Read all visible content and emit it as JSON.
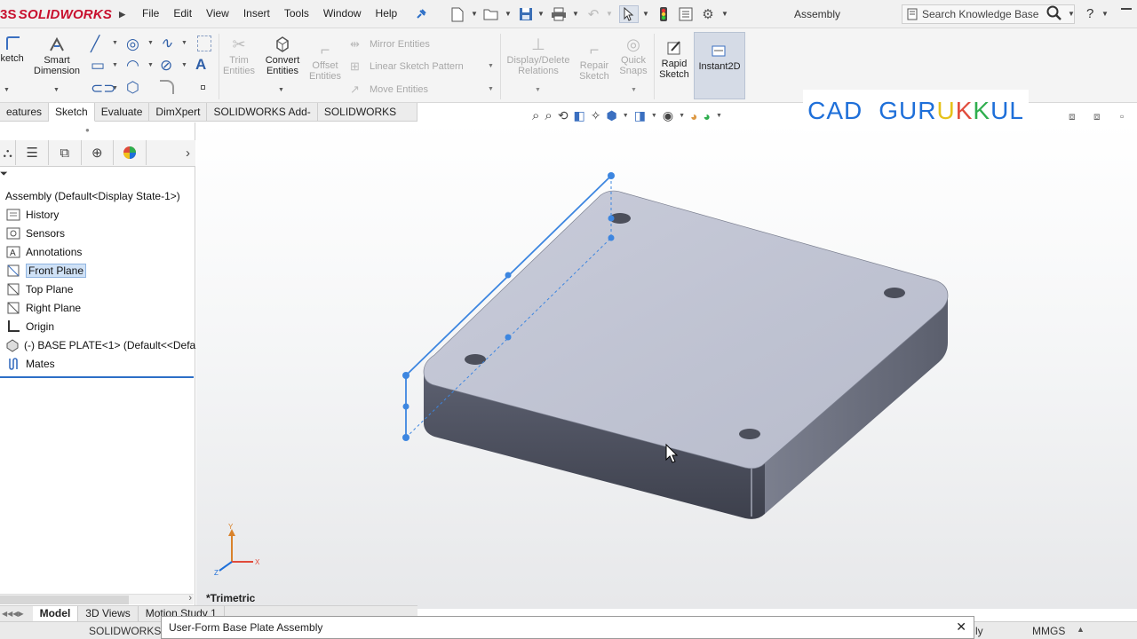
{
  "app": {
    "logo_prefix": "3S",
    "logo_name": "SOLIDWORKS",
    "document_title": "Assembly"
  },
  "menu": [
    "File",
    "Edit",
    "View",
    "Insert",
    "Tools",
    "Window",
    "Help"
  ],
  "search": {
    "placeholder": "Search Knowledge Base"
  },
  "help_label": "?",
  "ribbon": {
    "sketch_label": "Sketch",
    "smart_dimension": {
      "line1": "Smart",
      "line2": "Dimension"
    },
    "trim": {
      "line1": "Trim",
      "line2": "Entities"
    },
    "convert": {
      "line1": "Convert",
      "line2": "Entities"
    },
    "offset": {
      "line1": "Offset",
      "line2": "Entities"
    },
    "mirror_entities": "Mirror Entities",
    "linear_sketch_pattern": "Linear Sketch Pattern",
    "move_entities": "Move Entities",
    "display_delete": {
      "line1": "Display/Delete",
      "line2": "Relations"
    },
    "repair": {
      "line1": "Repair",
      "line2": "Sketch"
    },
    "quick_snaps": {
      "line1": "Quick",
      "line2": "Snaps"
    },
    "rapid_sketch": {
      "line1": "Rapid",
      "line2": "Sketch"
    },
    "instant2d": "Instant2D"
  },
  "command_tabs": [
    "eatures",
    "Sketch",
    "Evaluate",
    "DimXpert",
    "SOLIDWORKS Add-Ins",
    "SOLIDWORKS MBD"
  ],
  "active_tab": "Sketch",
  "feature_tree": {
    "root": "Assembly  (Default<Display State-1>)",
    "items": [
      {
        "label": "History",
        "icon": "history-icon"
      },
      {
        "label": "Sensors",
        "icon": "sensors-icon"
      },
      {
        "label": "Annotations",
        "icon": "annotations-icon"
      },
      {
        "label": "Front Plane",
        "icon": "plane-icon",
        "selected": true
      },
      {
        "label": "Top Plane",
        "icon": "plane-icon"
      },
      {
        "label": "Right Plane",
        "icon": "plane-icon"
      },
      {
        "label": "Origin",
        "icon": "origin-icon"
      },
      {
        "label": "(-)  BASE PLATE<1> (Default<<Defa",
        "icon": "part-icon"
      },
      {
        "label": "Mates",
        "icon": "mates-icon"
      }
    ]
  },
  "watermark": {
    "letters": [
      "C",
      "A",
      "D",
      " ",
      "G",
      "U",
      "R",
      "U",
      "K",
      "K",
      "U",
      "L"
    ],
    "colors": [
      "#1e6fd9",
      "#1e6fd9",
      "#1e6fd9",
      "#ffffff",
      "#1e6fd9",
      "#1e6fd9",
      "#1e6fd9",
      "#e6c21a",
      "#e14b3b",
      "#2fae4e",
      "#1e6fd9",
      "#1e6fd9"
    ]
  },
  "viewport": {
    "view_name": "*Trimetric"
  },
  "bottom_tabs": [
    "Model",
    "3D Views",
    "Motion Study 1"
  ],
  "status": {
    "left": "SOLIDWORKS P",
    "right_partial": "ly",
    "units": "MMGS"
  },
  "user_form": {
    "title": "User-Form Base Plate Assembly",
    "close": "✕"
  },
  "colors": {
    "accent": "#1e6fd9",
    "selection": "#cfe1f6",
    "brand_red": "#c8102e"
  }
}
